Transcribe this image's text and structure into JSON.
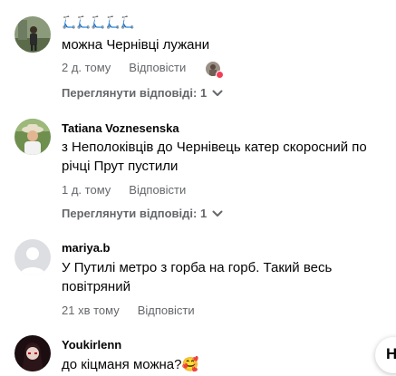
{
  "comments": [
    {
      "author": "🛴🛴🛴🛴🛴",
      "text": "можна Чернівці лужани",
      "time": "2 д. тому",
      "reply_label": "Відповісти",
      "replies_label": "Переглянути відповіді: 1",
      "avatar_icon": "person-photo-outdoor"
    },
    {
      "author": "Tatiana Voznesenska",
      "text": "з Неполоківців до Чернівець катер скоросний по річці Прут пустили",
      "time": "1 д. тому",
      "reply_label": "Відповісти",
      "replies_label": "Переглянути відповіді: 1",
      "avatar_icon": "person-photo-hat"
    },
    {
      "author": "mariya.b",
      "text": "У Путилі метро з горба на горб. Такий весь повітряний",
      "time": "21 хв тому",
      "reply_label": "Відповісти",
      "avatar_icon": "default-avatar"
    },
    {
      "author": "Youkirlenn",
      "text": "до кіцманя можна?🥰",
      "avatar_icon": "anime-avatar"
    }
  ],
  "floating_button_label": "Н",
  "colors": {
    "text": "#050505",
    "secondary": "#65676b",
    "heart": "#f33e58"
  }
}
